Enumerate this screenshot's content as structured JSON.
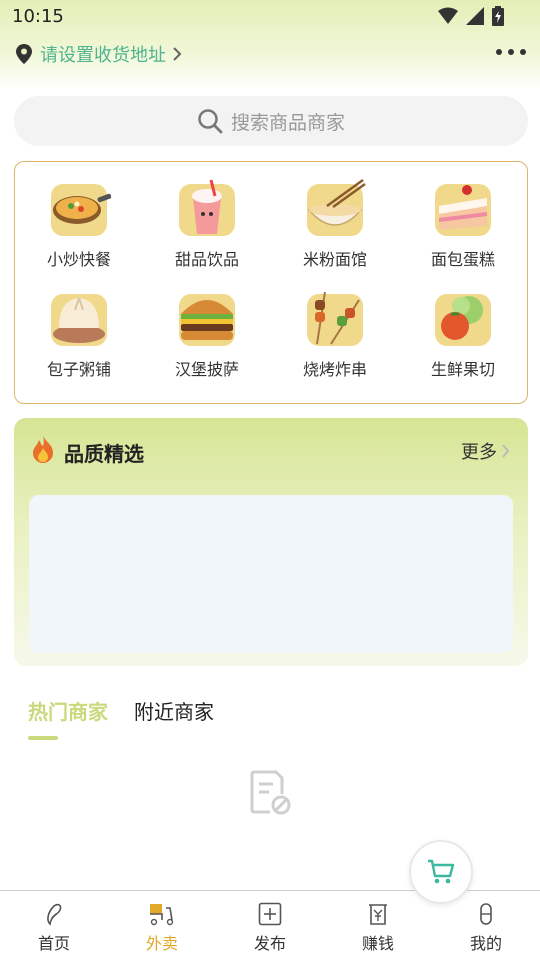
{
  "status_bar": {
    "time": "10:15"
  },
  "header": {
    "address": "请设置收货地址"
  },
  "search": {
    "placeholder": "搜索商品商家"
  },
  "categories": [
    {
      "label": "小炒快餐",
      "icon": "stir-fry-icon"
    },
    {
      "label": "甜品饮品",
      "icon": "drink-icon"
    },
    {
      "label": "米粉面馆",
      "icon": "noodle-icon"
    },
    {
      "label": "面包蛋糕",
      "icon": "cake-icon"
    },
    {
      "label": "包子粥铺",
      "icon": "bun-icon"
    },
    {
      "label": "汉堡披萨",
      "icon": "burger-icon"
    },
    {
      "label": "烧烤炸串",
      "icon": "skewer-icon"
    },
    {
      "label": "生鲜果切",
      "icon": "fruit-icon"
    }
  ],
  "quality": {
    "title": "品质精选",
    "more": "更多"
  },
  "tabs": [
    {
      "label": "热门商家",
      "active": true
    },
    {
      "label": "附近商家",
      "active": false
    }
  ],
  "tabbar": [
    {
      "label": "首页",
      "icon": "home-icon",
      "active": false
    },
    {
      "label": "外卖",
      "icon": "delivery-icon",
      "active": true
    },
    {
      "label": "发布",
      "icon": "publish-icon",
      "active": false
    },
    {
      "label": "赚钱",
      "icon": "earn-icon",
      "active": false
    },
    {
      "label": "我的",
      "icon": "profile-icon",
      "active": false
    }
  ],
  "colors": {
    "accent_green": "#4fb48f",
    "brand_lime": "#c9d97c",
    "active_tab": "#e0a92a",
    "card_border": "#e0b56a"
  }
}
